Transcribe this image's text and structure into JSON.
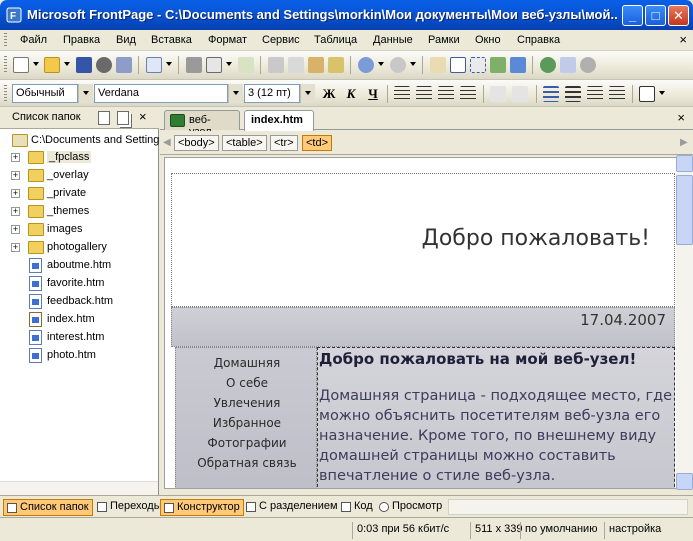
{
  "window": {
    "title": "Microsoft FrontPage - C:\\Documents and Settings\\morkin\\Мои документы\\Мои веб-узлы\\мой...",
    "minimize": "_",
    "maximize": "□",
    "close": "✕"
  },
  "menu": {
    "items": [
      "Файл",
      "Правка",
      "Вид",
      "Вставка",
      "Формат",
      "Сервис",
      "Таблица",
      "Данные",
      "Рамки",
      "Окно",
      "Справка"
    ],
    "close": "×"
  },
  "toolbar2": {
    "style_value": "Обычный",
    "font_value": "Verdana",
    "size_value": "3  (12 пт)",
    "bold": "Ж",
    "italic": "К",
    "underline": "Ч"
  },
  "folder_pane": {
    "title": "Список папок",
    "close": "×",
    "root": "C:\\Documents and Settings",
    "items": [
      {
        "label": "_fpclass",
        "type": "folder"
      },
      {
        "label": "_overlay",
        "type": "folder"
      },
      {
        "label": "_private",
        "type": "folder"
      },
      {
        "label": "_themes",
        "type": "folder"
      },
      {
        "label": "images",
        "type": "folder"
      },
      {
        "label": "photogallery",
        "type": "folder"
      },
      {
        "label": "aboutme.htm",
        "type": "file"
      },
      {
        "label": "favorite.htm",
        "type": "file"
      },
      {
        "label": "feedback.htm",
        "type": "file"
      },
      {
        "label": "index.htm",
        "type": "file"
      },
      {
        "label": "interest.htm",
        "type": "file"
      },
      {
        "label": "photo.htm",
        "type": "file"
      }
    ]
  },
  "doc": {
    "tabs": [
      "веб-узел",
      "index.htm"
    ],
    "close": "×",
    "tags": [
      "<body>",
      "<table>",
      "<tr>",
      "<td>"
    ]
  },
  "page": {
    "welcome": "Добро пожаловать!",
    "date": "17.04.2007",
    "nav": [
      "Домашняя",
      "О себе",
      "Увлечения",
      "Избранное",
      "Фотографии",
      "Обратная связь"
    ],
    "heading": "Добро пожаловать на мой веб-узел!",
    "paragraph": "Домашняя страница - подходящее место, где можно объяснить посетителям веб-узла его назначение. Кроме того, по внешнему виду домашней страницы можно составить впечатление о стиле веб-узла."
  },
  "view_tabs": [
    "Список папок",
    "Переходы",
    "Конструктор",
    "С разделением",
    "Код",
    "Просмотр"
  ],
  "status": {
    "download": "0:03 при 56 кбит/с",
    "dimensions": "511 x 339",
    "mode": "по умолчанию",
    "custom": "настройка"
  }
}
